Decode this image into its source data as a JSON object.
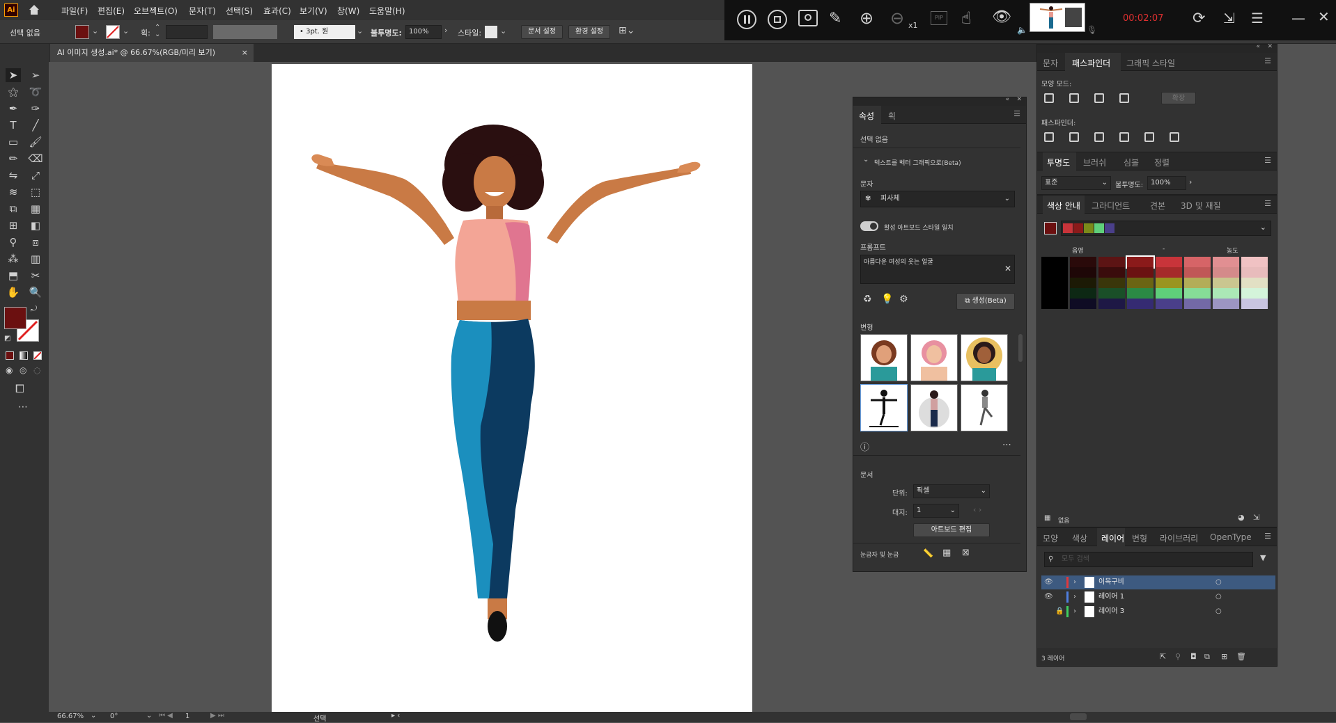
{
  "app": {
    "logo": "Ai"
  },
  "menu": [
    "파일(F)",
    "편집(E)",
    "오브젝트(O)",
    "문자(T)",
    "선택(S)",
    "효과(C)",
    "보기(V)",
    "창(W)",
    "도움말(H)"
  ],
  "control_bar": {
    "selection": "선택 없음",
    "stroke_label": "획:",
    "brush": "3pt. 원",
    "opacity_label": "불투명도:",
    "opacity_value": "100%",
    "style_label": "스타일:",
    "doc_setup": "문서 설정",
    "preferences": "환경 설정"
  },
  "recorder": {
    "zoom": "x1",
    "pip": "PIP",
    "timer": "00:02:07"
  },
  "document_tab": {
    "title": "AI 이미지 생성.ai* @ 66.67%(RGB/미리 보기)",
    "close": "×"
  },
  "status_bar": {
    "zoom": "66.67%",
    "rotation": "0°",
    "artboard": "1",
    "tool": "선택"
  },
  "properties_panel": {
    "tabs": [
      "속성",
      "획"
    ],
    "no_selection": "선택 없음",
    "section_title": "텍스트를 벡터 그래픽으로(Beta)",
    "type_label": "문자",
    "type_value": "피사체",
    "toggle_label": "활성 아트보드 스타일 일치",
    "prompt_label": "프롬프트",
    "prompt_text": "아름다운 여성의 웃는 얼굴",
    "generate_label": "생성(Beta)",
    "variations_label": "변형",
    "document_label": "문서",
    "units_label": "단위:",
    "units_value": "픽셀",
    "artboard_label": "대지:",
    "artboard_value": "1",
    "edit_artboard": "아트보드 편집",
    "rulers_label": "눈금자 및 눈금"
  },
  "pathfinder_panel": {
    "tabs": [
      "문자",
      "패스파인더",
      "그래픽 스타일"
    ],
    "shape_modes": "모양 모드:",
    "expand": "확장",
    "pathfinders": "패스파인더:"
  },
  "transparency_panel": {
    "tabs": [
      "투명도",
      "브러쉬",
      "심볼",
      "정렬"
    ],
    "blend_mode": "표준",
    "opacity_label": "불투명도:",
    "opacity_value": "100%"
  },
  "color_guide_panel": {
    "tabs": [
      "색상 안내",
      "그라디언트",
      "견본",
      "3D 및 재질"
    ],
    "shade_label": "음영",
    "tint_label": "농도",
    "footer": "없음",
    "harmony_colors": [
      "#c8343a",
      "#8b1a1a",
      "#7a8a1a",
      "#5fcf7a",
      "#4a3f8a"
    ],
    "grid": [
      [
        "#000000",
        "#2a0a0a",
        "#5c1414",
        "#8b1a1a",
        "#c8343a",
        "#d66467",
        "#e18f92",
        "#f0c2c3"
      ],
      [
        "#000000",
        "#1e0707",
        "#3a0c0c",
        "#6b1212",
        "#a52a2a",
        "#c05757",
        "#d48a8a",
        "#e8bcbc"
      ],
      [
        "#000000",
        "#1c1a05",
        "#3a360a",
        "#6b6513",
        "#9a9420",
        "#b3ad58",
        "#cac690",
        "#e2e0c4"
      ],
      [
        "#000000",
        "#0d2814",
        "#1a4f28",
        "#2b8a45",
        "#5fcf7a",
        "#86dc97",
        "#abe8b6",
        "#d4f4da"
      ],
      [
        "#000000",
        "#0f0c24",
        "#1e1845",
        "#352b72",
        "#4a3f8a",
        "#7369a6",
        "#9c95c2",
        "#c9c5e0"
      ]
    ]
  },
  "layers_panel": {
    "tabs": [
      "모양",
      "색상",
      "레이어",
      "변형",
      "라이브러리",
      "OpenType"
    ],
    "search_placeholder": "모두 검색",
    "layers": [
      {
        "name": "이목구비",
        "color": "#e0383c",
        "visible": true,
        "locked": false
      },
      {
        "name": "레이어 1",
        "color": "#4f7fe0",
        "visible": true,
        "locked": false
      },
      {
        "name": "레이어 3",
        "color": "#3fd05f",
        "visible": false,
        "locked": true
      }
    ],
    "footer": "3 레이어"
  },
  "colors": {
    "fill": "#6b1010",
    "accent": "#2d7fd3",
    "timer": "#e03030"
  }
}
